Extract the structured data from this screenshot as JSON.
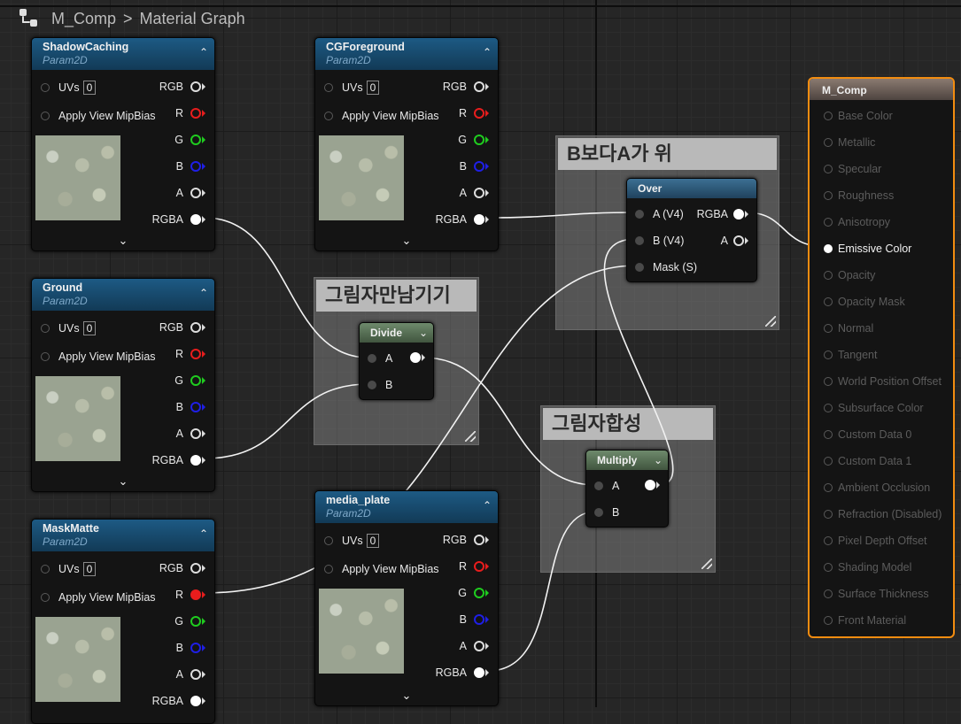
{
  "breadcrumb": {
    "asset": "M_Comp",
    "separator": ">",
    "graph": "Material Graph"
  },
  "param_nodes": [
    {
      "title": "ShadowCaching",
      "subtitle": "Param2D",
      "uvs_label": "UVs",
      "uvs_value": "0",
      "mip_label": "Apply View MipBias",
      "outputs": [
        "RGB",
        "R",
        "G",
        "B",
        "A",
        "RGBA"
      ]
    },
    {
      "title": "CGForeground",
      "subtitle": "Param2D",
      "uvs_label": "UVs",
      "uvs_value": "0",
      "mip_label": "Apply View MipBias",
      "outputs": [
        "RGB",
        "R",
        "G",
        "B",
        "A",
        "RGBA"
      ]
    },
    {
      "title": "Ground",
      "subtitle": "Param2D",
      "uvs_label": "UVs",
      "uvs_value": "0",
      "mip_label": "Apply View MipBias",
      "outputs": [
        "RGB",
        "R",
        "G",
        "B",
        "A",
        "RGBA"
      ]
    },
    {
      "title": "MaskMatte",
      "subtitle": "Param2D",
      "uvs_label": "UVs",
      "uvs_value": "0",
      "mip_label": "Apply View MipBias",
      "outputs": [
        "RGB",
        "R",
        "G",
        "B",
        "A",
        "RGBA"
      ]
    },
    {
      "title": "media_plate",
      "subtitle": "Param2D",
      "uvs_label": "UVs",
      "uvs_value": "0",
      "mip_label": "Apply View MipBias",
      "outputs": [
        "RGB",
        "R",
        "G",
        "B",
        "A",
        "RGBA"
      ]
    }
  ],
  "comments": {
    "over_group": "B보다A가 위",
    "divide_group": "그림자만남기기",
    "multiply_group": "그림자합성"
  },
  "over_node": {
    "title": "Over",
    "in_a": "A (V4)",
    "in_b": "B (V4)",
    "in_mask": "Mask (S)",
    "out_rgba": "RGBA",
    "out_a": "A"
  },
  "divide_node": {
    "title": "Divide",
    "in_a": "A",
    "in_b": "B"
  },
  "multiply_node": {
    "title": "Multiply",
    "in_a": "A",
    "in_b": "B"
  },
  "result_node": {
    "title": "M_Comp",
    "inputs": [
      "Base Color",
      "Metallic",
      "Specular",
      "Roughness",
      "Anisotropy",
      "Emissive Color",
      "Opacity",
      "Opacity Mask",
      "Normal",
      "Tangent",
      "World Position Offset",
      "Subsurface Color",
      "Custom Data 0",
      "Custom Data 1",
      "Ambient Occlusion",
      "Refraction (Disabled)",
      "Pixel Depth Offset",
      "Shading Model",
      "Surface Thickness",
      "Front Material"
    ],
    "active_input": "Emissive Color"
  },
  "colors": {
    "accent": "#f28c10",
    "wire": "#ffffff",
    "red_pin": "#e81d1d",
    "green_pin": "#1fcc1f",
    "blue_pin": "#1f1fe6"
  }
}
